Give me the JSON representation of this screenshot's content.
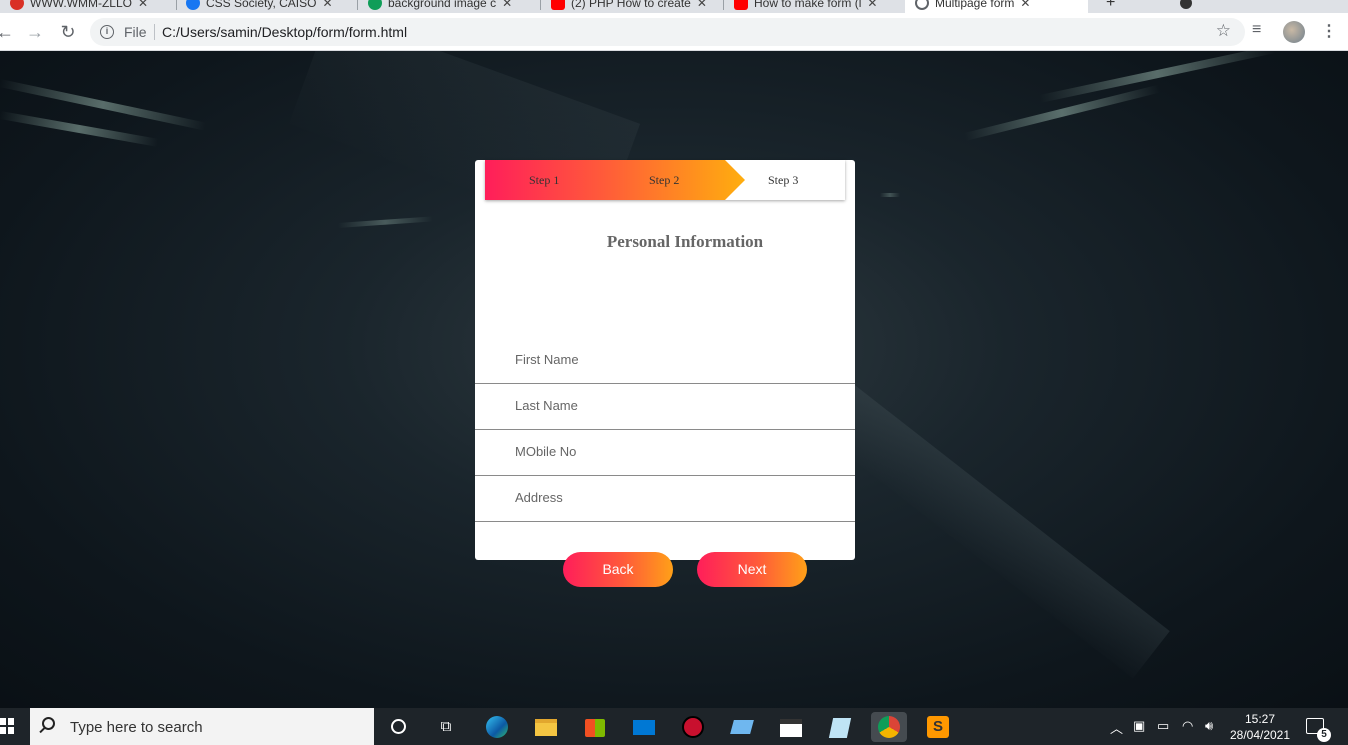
{
  "browser": {
    "tabs": [
      {
        "title": "WWW.WMM-ZLLO",
        "favicon_color": "#d93025"
      },
      {
        "title": "CSS Society, CAISO",
        "favicon_color": "#1877f2"
      },
      {
        "title": "background image c",
        "favicon_color": "#0f9d58"
      },
      {
        "title": "(2) PHP How to create",
        "favicon_color": "#ff0000"
      },
      {
        "title": "How to make form (l",
        "favicon_color": "#ff0000"
      },
      {
        "title": "Multipage form",
        "favicon_color": "#5f6368"
      }
    ],
    "address": {
      "scheme_label": "File",
      "url": "C:/Users/samin/Desktop/form/form.html"
    }
  },
  "form": {
    "steps": [
      "Step 1",
      "Step 2",
      "Step 3"
    ],
    "progress_completed_steps": 2,
    "title": "Personal Information",
    "fields": [
      {
        "placeholder": "First Name",
        "value": ""
      },
      {
        "placeholder": "Last Name",
        "value": ""
      },
      {
        "placeholder": "MObile No",
        "value": ""
      },
      {
        "placeholder": "Address",
        "value": ""
      }
    ],
    "buttons": {
      "back": "Back",
      "next": "Next"
    },
    "gradient": {
      "start": "#ff1e5a",
      "end": "#ffae0e"
    }
  },
  "taskbar": {
    "search_placeholder": "Type here to search",
    "time": "15:27",
    "date": "28/04/2021",
    "notification_count": "5"
  }
}
